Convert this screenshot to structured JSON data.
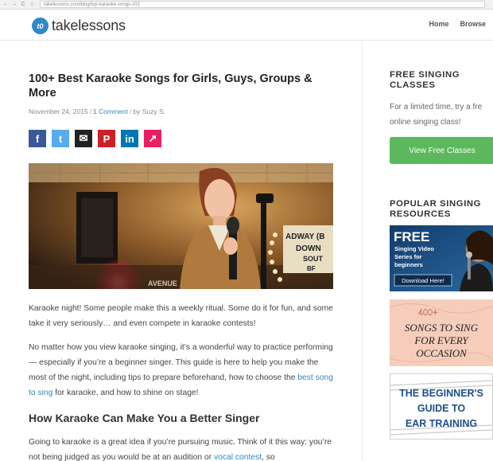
{
  "browser": {
    "url": "takelessons.com/blog/top-karaoke-songs-z02",
    "nav": [
      "←",
      "→",
      "C",
      "⌂"
    ]
  },
  "header": {
    "logo_mark": "t0",
    "logo_text": "takelessons",
    "nav": [
      {
        "label": "Home"
      },
      {
        "label": "Browse"
      }
    ]
  },
  "article": {
    "title": "100+ Best Karaoke Songs for Girls, Guys, Groups & More",
    "meta": {
      "date": "November 24, 2015",
      "comments": "1 Comment",
      "author": "by Suzy S."
    },
    "share_buttons": [
      {
        "name": "facebook",
        "glyph": "f",
        "color": "#3b5998"
      },
      {
        "name": "twitter",
        "glyph": "t",
        "color": "#55acee"
      },
      {
        "name": "email",
        "glyph": "✉",
        "color": "#222222"
      },
      {
        "name": "pinterest",
        "glyph": "P",
        "color": "#cb2027"
      },
      {
        "name": "linkedin",
        "glyph": "in",
        "color": "#0077b5"
      },
      {
        "name": "share",
        "glyph": "↗",
        "color": "#e91e63"
      }
    ],
    "photo_sign": {
      "top": "ADWAY (B",
      "line2": "DOWN",
      "line3": "SOUT",
      "line4": "BF",
      "left": "AVENUE"
    },
    "p1": "Karaoke night! Some people make this a weekly ritual. Some do it for fun, and some take it very seriously… and even compete in karaoke contests!",
    "p2_before": "No matter how you view karaoke singing, it’s a wonderful way to practice performing — especially if you’re a beginner singer. This guide is here to help you make the most of the night, including tips to prepare beforehand, how to choose the ",
    "p2_link": "best song to sing",
    "p2_after": " for karaoke, and how to shine on stage!",
    "h2": "How Karaoke Can Make You a Better Singer",
    "p3_before": "Going to karaoke is a great idea if you’re pursuing music. Think of it this way: you’re not being judged as you would be at an audition or ",
    "p3_link": "vocal contest",
    "p3_after": ", so"
  },
  "sidebar": {
    "free_heading": "FREE SINGING CLASSES",
    "free_text_l1": "For a limited time, try a fre",
    "free_text_l2": "online singing class!",
    "cta_label": "View Free Classes",
    "popular_heading": "POPULAR SINGING RESOURCES",
    "resources": [
      {
        "big": "FREE",
        "sub": "Singing Video Series for beginners",
        "button": "Download Here!"
      },
      {
        "top": "400+",
        "l1": "SONGS TO SING",
        "l2": "FOR EVERY",
        "l3": "OCCASION"
      },
      {
        "l1": "THE BEGINNER'S",
        "l2": "GUIDE TO",
        "l3": "EAR TRAINING"
      }
    ]
  }
}
